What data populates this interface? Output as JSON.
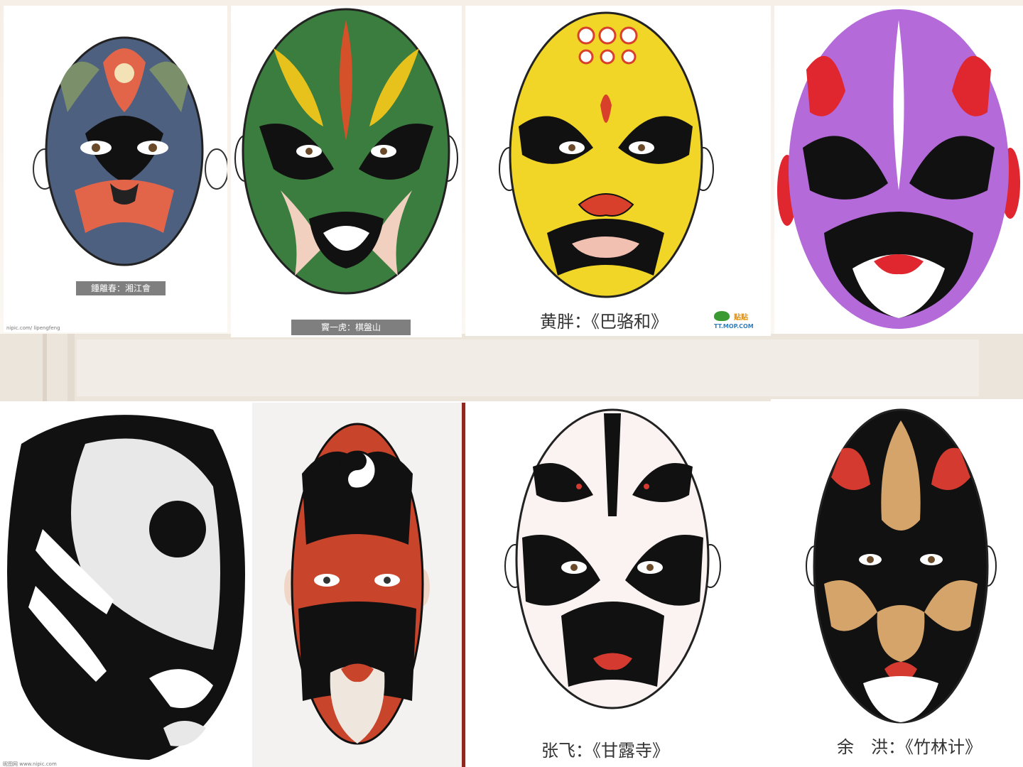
{
  "masks": [
    {
      "name": "mask-blue-lotus",
      "caption": "鍾離春：湘江會",
      "watermark": "nipic.com/ lipengfeng",
      "colors": {
        "base": "#4e6080",
        "accent": "#e2654a",
        "secondary": "#7a8f6a"
      }
    },
    {
      "name": "mask-green",
      "caption": "竇一虎：棋盤山",
      "colors": {
        "base": "#3a7d3e",
        "accent": "#d4512a",
        "secondary": "#e8c21c"
      }
    },
    {
      "name": "mask-yellow",
      "caption": "黄胖：《巴骆和》",
      "logo_text": "TT.MOP.COM",
      "logo_cn": "贴贴",
      "colors": {
        "base": "#f2d627",
        "accent": "#d9402b",
        "secondary": "#111111"
      }
    },
    {
      "name": "mask-purple",
      "colors": {
        "base": "#b46ad8",
        "accent": "#e0262e",
        "secondary": "#111111"
      }
    },
    {
      "name": "mask-black-white",
      "watermark": "昵图网 www.nipic.com",
      "colors": {
        "base": "#111111",
        "accent": "#ffffff"
      }
    },
    {
      "name": "mask-red-taiji",
      "colors": {
        "base": "#c8442a",
        "accent": "#111111",
        "secondary": "#ffffff"
      }
    },
    {
      "name": "mask-white-zhangfei",
      "caption": "张飞：《甘露寺》",
      "colors": {
        "base": "#ffffff",
        "accent": "#111111",
        "secondary": "#d43a2f"
      }
    },
    {
      "name": "mask-black-yuhong",
      "caption": "余　洪：《竹林计》",
      "colors": {
        "base": "#111111",
        "accent": "#d4a46a",
        "secondary": "#d43a2f"
      }
    }
  ]
}
